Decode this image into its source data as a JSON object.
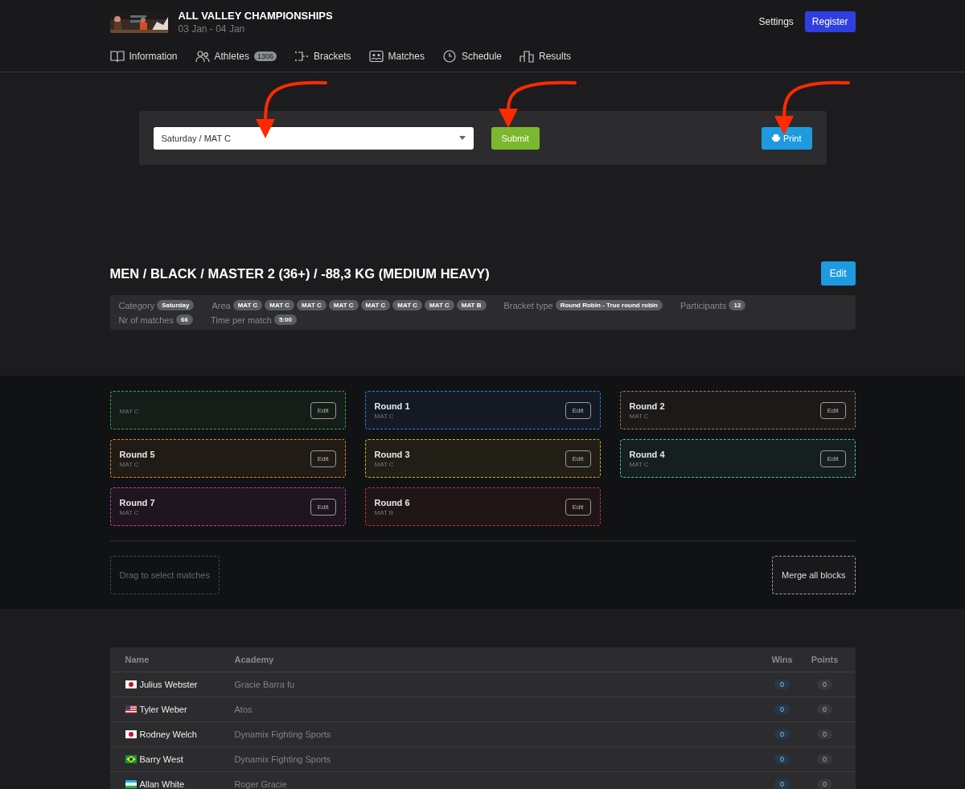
{
  "header": {
    "title": "ALL VALLEY CHAMPIONSHIPS",
    "dates": "03 Jan - 04 Jan",
    "settings": "Settings",
    "register": "Register"
  },
  "nav": [
    {
      "kind": "book",
      "label": "Information"
    },
    {
      "kind": "people",
      "label": "Athletes",
      "badge": "1306"
    },
    {
      "kind": "bracket",
      "label": "Brackets"
    },
    {
      "kind": "matches",
      "label": "Matches"
    },
    {
      "kind": "clock",
      "label": "Schedule"
    },
    {
      "kind": "podium",
      "label": "Results"
    }
  ],
  "filter": {
    "select_value": "Saturday / MAT C",
    "submit": "Submit",
    "print": "Print"
  },
  "annotation_arrows": [
    {
      "kind": "curved"
    },
    {
      "kind": "curved"
    },
    {
      "kind": "curved"
    }
  ],
  "bracket": {
    "title": "MEN / BLACK / MASTER 2 (36+) / -88,3 KG (MEDIUM HEAVY)",
    "edit": "Edit",
    "info": [
      {
        "label": "Category",
        "tags": [
          "Saturday"
        ]
      },
      {
        "label": "Area",
        "tags": [
          "MAT C",
          "MAT C",
          "MAT C",
          "MAT C",
          "MAT C",
          "MAT C",
          "MAT C",
          "MAT B"
        ]
      },
      {
        "label": "Bracket type",
        "tags": [
          "Round Robin - True round robin"
        ]
      },
      {
        "label": "Participants",
        "tags": [
          "12"
        ]
      },
      {
        "label": "Nr of matches",
        "tags": [
          "66"
        ]
      },
      {
        "label": "Time per match",
        "tags": [
          "5:00"
        ]
      }
    ]
  },
  "blocks": [
    {
      "mat": "MAT C",
      "color": "#3fa34d",
      "edit": "Edit"
    },
    {
      "title": "Round 1",
      "mat": "MAT C",
      "color": "#2f7fe0",
      "edit": "Edit"
    },
    {
      "title": "Round 2",
      "mat": "MAT C",
      "color": "#a07a55",
      "edit": "Edit"
    },
    {
      "title": "Round 5",
      "mat": "MAT C",
      "color": "#e08a20",
      "edit": "Edit"
    },
    {
      "title": "Round 3",
      "mat": "MAT C",
      "color": "#d8b420",
      "edit": "Edit"
    },
    {
      "title": "Round 4",
      "mat": "MAT C",
      "color": "#4fc0b0",
      "edit": "Edit"
    },
    {
      "title": "Round 7",
      "mat": "MAT C",
      "color": "#c040a0",
      "edit": "Edit"
    },
    {
      "title": "Round 6",
      "mat": "MAT B",
      "color": "#c83232",
      "edit": "Edit"
    }
  ],
  "block_actions": {
    "drag": "Drag to select matches",
    "merge": "Merge all blocks"
  },
  "table": {
    "columns": [
      "Name",
      "Academy",
      "Wins",
      "Points"
    ],
    "rows": [
      {
        "kind": "jp",
        "name": "Julius Webster",
        "academy": "Gracie Barra fu",
        "wins": "0",
        "points": "0"
      },
      {
        "kind": "us",
        "name": "Tyler Weber",
        "academy": "Atos",
        "wins": "0",
        "points": "0"
      },
      {
        "kind": "jp",
        "name": "Rodney Welch",
        "academy": "Dynamix Fighting Sports",
        "wins": "0",
        "points": "0"
      },
      {
        "kind": "br",
        "name": "Barry West",
        "academy": "Dynamix Fighting Sports",
        "wins": "0",
        "points": "0"
      },
      {
        "kind": "uz",
        "name": "Allan White",
        "academy": "Roger Gracie",
        "wins": "0",
        "points": "0"
      }
    ]
  }
}
